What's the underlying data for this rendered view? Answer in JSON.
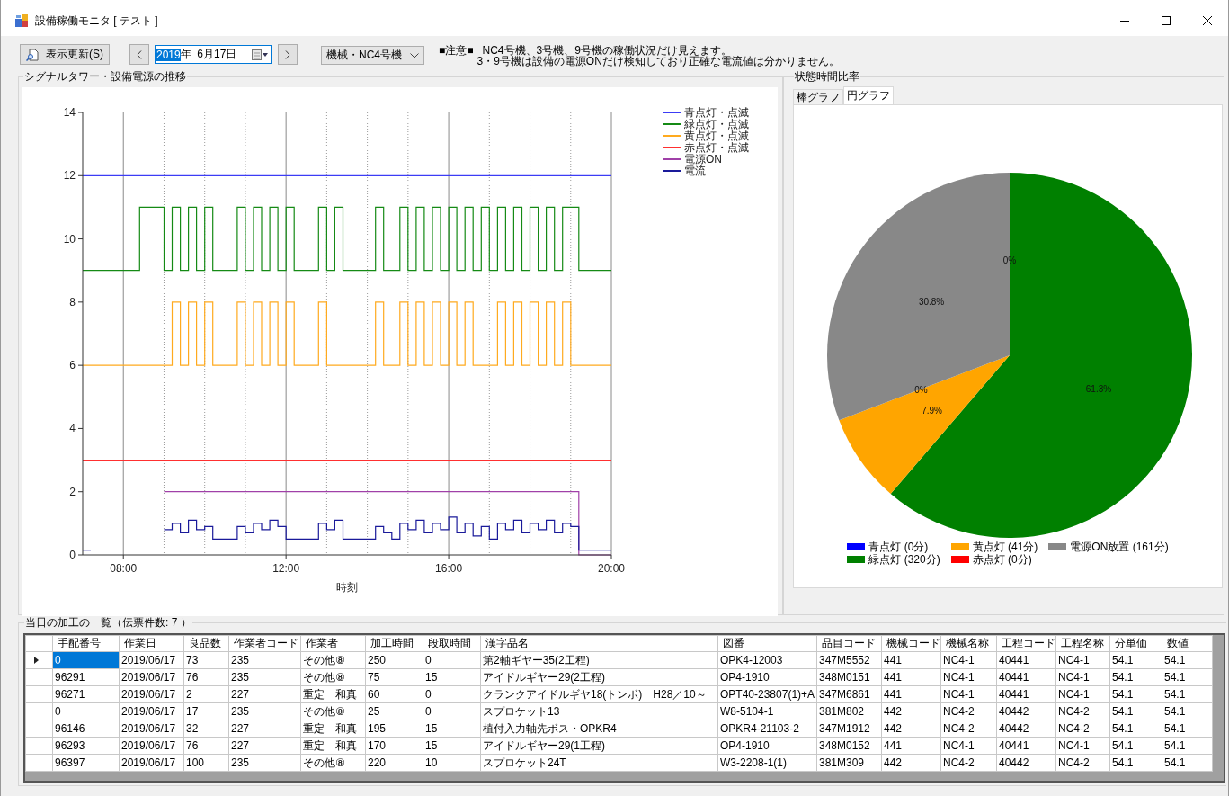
{
  "window": {
    "title": "設備稼働モニタ [ テスト ]"
  },
  "toolbar": {
    "refresh_button": "表示更新(S)",
    "date_picker": {
      "segments": [
        {
          "text": "2019",
          "selected": true
        },
        {
          "text": "年  6月17日",
          "selected": false
        }
      ]
    },
    "machine_combo": {
      "value": "機械・NC4号機"
    },
    "notice": {
      "label": "■注意■",
      "lines": [
        "NC4号機、3号機、9号機の稼働状況だけ見えます。",
        "3・9号機は設備の電源ONだけ検知しており正確な電流値は分かりません。"
      ]
    }
  },
  "signal_panel": {
    "title": "シグナルタワー・設備電源の推移",
    "chart_data": {
      "type": "line",
      "xlabel": "時刻",
      "xlim": [
        7,
        20
      ],
      "ylim": [
        0,
        14
      ],
      "grid": true,
      "legend": "right",
      "xticks": [
        {
          "value": 8,
          "label": "08:00"
        },
        {
          "value": 12,
          "label": "12:00"
        },
        {
          "value": 16,
          "label": "16:00"
        },
        {
          "value": 20,
          "label": "20:00"
        }
      ],
      "yticks": [
        0,
        2,
        4,
        6,
        8,
        10,
        12,
        14
      ],
      "x": [
        7,
        7.2,
        7.2,
        7.4,
        7.4,
        7.6,
        7.6,
        7.8,
        7.8,
        8,
        8,
        8.2,
        8.2,
        8.4,
        8.4,
        8.6,
        8.6,
        8.8,
        8.8,
        9,
        9,
        9.2,
        9.2,
        9.4,
        9.4,
        9.6,
        9.6,
        9.8,
        9.8,
        10,
        10,
        10.2,
        10.2,
        10.4,
        10.4,
        10.6,
        10.6,
        10.8,
        10.8,
        11,
        11,
        11.2,
        11.2,
        11.4,
        11.4,
        11.6,
        11.6,
        11.8,
        11.8,
        12,
        12,
        12.2,
        12.2,
        12.4,
        12.4,
        12.6,
        12.6,
        12.8,
        12.8,
        13,
        13,
        13.2,
        13.2,
        13.4,
        13.4,
        13.6,
        13.6,
        13.8,
        13.8,
        14,
        14,
        14.2,
        14.2,
        14.4,
        14.4,
        14.6,
        14.6,
        14.8,
        14.8,
        15,
        15,
        15.2,
        15.2,
        15.4,
        15.4,
        15.6,
        15.6,
        15.8,
        15.8,
        16,
        16,
        16.2,
        16.2,
        16.4,
        16.4,
        16.6,
        16.6,
        16.8,
        16.8,
        17,
        17,
        17.2,
        17.2,
        17.4,
        17.4,
        17.6,
        17.6,
        17.8,
        17.8,
        18,
        18,
        18.2,
        18.2,
        18.4,
        18.4,
        18.6,
        18.6,
        18.8,
        18.8,
        19,
        19,
        19.2,
        19.2,
        19.4,
        19.4,
        19.6,
        19.6,
        19.8,
        19.8,
        20
      ],
      "series": [
        {
          "name": "青点灯・点滅",
          "color": "#3c3cf5",
          "values": [
            12,
            12,
            12,
            12,
            12,
            12,
            12,
            12,
            12,
            12,
            12,
            12,
            12,
            12,
            12,
            12,
            12,
            12,
            12,
            12,
            12,
            12,
            12,
            12,
            12,
            12,
            12,
            12,
            12,
            12,
            12,
            12,
            12,
            12,
            12,
            12,
            12,
            12,
            12,
            12,
            12,
            12,
            12,
            12,
            12,
            12,
            12,
            12,
            12,
            12,
            12,
            12,
            12,
            12,
            12,
            12,
            12,
            12,
            12,
            12,
            12,
            12,
            12,
            12,
            12,
            12,
            12,
            12,
            12,
            12,
            12,
            12,
            12,
            12,
            12,
            12,
            12,
            12,
            12,
            12,
            12,
            12,
            12,
            12,
            12,
            12,
            12,
            12,
            12,
            12,
            12,
            12,
            12,
            12,
            12,
            12,
            12,
            12,
            12,
            12,
            12,
            12,
            12,
            12,
            12,
            12,
            12,
            12,
            12,
            12,
            12,
            12,
            12,
            12,
            12,
            12,
            12,
            12,
            12,
            12,
            12,
            12,
            12,
            12,
            12,
            12,
            12,
            12,
            12,
            12
          ]
        },
        {
          "name": "緑点灯・点滅",
          "color": "#158a15",
          "values": [
            9,
            9,
            9,
            9,
            9,
            9,
            9,
            9,
            9,
            9,
            9,
            9,
            9,
            9,
            11,
            11,
            11,
            11,
            11,
            11,
            9,
            9,
            11,
            11,
            9,
            9,
            11,
            11,
            9,
            9,
            11,
            11,
            9,
            9,
            9,
            9,
            9,
            9,
            11,
            11,
            9,
            9,
            11,
            11,
            9,
            9,
            11,
            11,
            9,
            9,
            11,
            11,
            9,
            9,
            9,
            9,
            9,
            9,
            11,
            11,
            9,
            9,
            11,
            11,
            9,
            9,
            9,
            9,
            9,
            9,
            9,
            9,
            11,
            11,
            9,
            9,
            9,
            9,
            11,
            11,
            9,
            9,
            11,
            11,
            9,
            9,
            11,
            11,
            9,
            9,
            11,
            11,
            9,
            9,
            11,
            11,
            9,
            9,
            11,
            11,
            9,
            9,
            11,
            11,
            9,
            9,
            11,
            11,
            9,
            9,
            11,
            11,
            9,
            9,
            11,
            11,
            9,
            9,
            11,
            11,
            11,
            11,
            9,
            9,
            9,
            9,
            9,
            9,
            9,
            9
          ]
        },
        {
          "name": "黄点灯・点滅",
          "color": "#ffaa1e",
          "values": [
            6,
            6,
            6,
            6,
            6,
            6,
            6,
            6,
            6,
            6,
            6,
            6,
            6,
            6,
            6,
            6,
            6,
            6,
            6,
            6,
            6,
            6,
            8,
            8,
            6,
            6,
            8,
            8,
            6,
            6,
            8,
            8,
            6,
            6,
            6,
            6,
            6,
            6,
            8,
            8,
            6,
            6,
            8,
            8,
            6,
            6,
            8,
            8,
            6,
            6,
            8,
            8,
            6,
            6,
            6,
            6,
            6,
            6,
            8,
            8,
            6,
            6,
            6,
            6,
            6,
            6,
            6,
            6,
            6,
            6,
            6,
            6,
            8,
            8,
            6,
            6,
            6,
            6,
            8,
            8,
            6,
            6,
            8,
            8,
            6,
            6,
            8,
            8,
            6,
            6,
            8,
            8,
            6,
            6,
            8,
            8,
            6,
            6,
            6,
            6,
            6,
            6,
            8,
            8,
            6,
            6,
            8,
            8,
            6,
            6,
            8,
            8,
            6,
            6,
            8,
            8,
            6,
            6,
            8,
            8,
            6,
            6,
            6,
            6,
            6,
            6,
            6,
            6,
            6,
            6
          ]
        },
        {
          "name": "赤点灯・点滅",
          "color": "#ff3030",
          "values": [
            3,
            3,
            3,
            3,
            3,
            3,
            3,
            3,
            3,
            3,
            3,
            3,
            3,
            3,
            3,
            3,
            3,
            3,
            3,
            3,
            3,
            3,
            3,
            3,
            3,
            3,
            3,
            3,
            3,
            3,
            3,
            3,
            3,
            3,
            3,
            3,
            3,
            3,
            3,
            3,
            3,
            3,
            3,
            3,
            3,
            3,
            3,
            3,
            3,
            3,
            3,
            3,
            3,
            3,
            3,
            3,
            3,
            3,
            3,
            3,
            3,
            3,
            3,
            3,
            3,
            3,
            3,
            3,
            3,
            3,
            3,
            3,
            3,
            3,
            3,
            3,
            3,
            3,
            3,
            3,
            3,
            3,
            3,
            3,
            3,
            3,
            3,
            3,
            3,
            3,
            3,
            3,
            3,
            3,
            3,
            3,
            3,
            3,
            3,
            3,
            3,
            3,
            3,
            3,
            3,
            3,
            3,
            3,
            3,
            3,
            3,
            3,
            3,
            3,
            3,
            3,
            3,
            3,
            3,
            3,
            3,
            3,
            3,
            3,
            3,
            3,
            3,
            3,
            3,
            3
          ]
        },
        {
          "name": "電源ON",
          "color": "#a040a8",
          "values": [
            null,
            null,
            null,
            null,
            null,
            null,
            null,
            null,
            null,
            null,
            null,
            null,
            null,
            null,
            null,
            null,
            null,
            null,
            null,
            null,
            2,
            2,
            2,
            2,
            2,
            2,
            2,
            2,
            2,
            2,
            2,
            2,
            2,
            2,
            2,
            2,
            2,
            2,
            2,
            2,
            2,
            2,
            2,
            2,
            2,
            2,
            2,
            2,
            2,
            2,
            2,
            2,
            2,
            2,
            2,
            2,
            2,
            2,
            2,
            2,
            2,
            2,
            2,
            2,
            2,
            2,
            2,
            2,
            2,
            2,
            2,
            2,
            2,
            2,
            2,
            2,
            2,
            2,
            2,
            2,
            2,
            2,
            2,
            2,
            2,
            2,
            2,
            2,
            2,
            2,
            2,
            2,
            2,
            2,
            2,
            2,
            2,
            2,
            2,
            2,
            2,
            2,
            2,
            2,
            2,
            2,
            2,
            2,
            2,
            2,
            2,
            2,
            2,
            2,
            2,
            2,
            2,
            2,
            2,
            2,
            2,
            2,
            0,
            0,
            0,
            0,
            0,
            0,
            0,
            0
          ]
        },
        {
          "name": "電流",
          "color": "#1a1a9a",
          "values": [
            0.15,
            0.15,
            null,
            null,
            null,
            null,
            null,
            null,
            null,
            null,
            null,
            null,
            null,
            null,
            null,
            null,
            null,
            null,
            null,
            null,
            0.8,
            0.8,
            1.0,
            1.0,
            0.7,
            0.7,
            1.1,
            1.1,
            0.8,
            0.8,
            0.9,
            0.9,
            0.5,
            0.5,
            0.5,
            0.5,
            0.5,
            0.5,
            0.9,
            0.9,
            0.7,
            0.7,
            1.0,
            1.0,
            0.8,
            0.8,
            1.1,
            1.1,
            0.9,
            0.9,
            0.5,
            0.5,
            0.5,
            0.5,
            0.5,
            0.5,
            0.5,
            0.5,
            1.0,
            1.0,
            0.8,
            0.8,
            1.1,
            1.1,
            0.5,
            0.5,
            0.5,
            0.5,
            0.5,
            0.5,
            0.5,
            0.5,
            0.9,
            0.9,
            0.7,
            0.7,
            0.5,
            0.5,
            1.0,
            1.0,
            0.8,
            0.8,
            1.1,
            1.1,
            0.7,
            0.7,
            1.0,
            1.0,
            0.8,
            0.8,
            1.2,
            1.2,
            0.7,
            0.7,
            1.0,
            1.0,
            0.6,
            0.6,
            0.9,
            0.9,
            0.5,
            0.5,
            1.0,
            1.0,
            0.8,
            0.8,
            1.1,
            1.1,
            0.7,
            0.7,
            1.0,
            1.0,
            0.8,
            0.8,
            1.1,
            1.1,
            0.7,
            0.7,
            1.0,
            1.0,
            0.9,
            0.9,
            0.15,
            0.15,
            0.15,
            0.15,
            0.15,
            0.15,
            0.15,
            0.15
          ]
        }
      ]
    }
  },
  "ratio_panel": {
    "title": "状態時間比率",
    "tabs": [
      {
        "label": "棒グラフ",
        "selected": false
      },
      {
        "label": "円グラフ",
        "selected": true
      }
    ],
    "chart_data": {
      "type": "pie",
      "legend": "bottom",
      "categories": [
        "青点灯 (0分)",
        "緑点灯 (320分)",
        "黄点灯 (41分)",
        "赤点灯 (0分)",
        "電源ON放置 (161分)"
      ],
      "values": [
        0,
        61.3,
        7.9,
        0,
        30.8
      ],
      "colors": [
        "#0000ff",
        "#008000",
        "#ffa500",
        "#ff0000",
        "#888888"
      ],
      "value_labels": [
        "0%",
        "61.3%",
        "7.9%",
        "0%",
        "30.8%"
      ]
    }
  },
  "work_list": {
    "title": "当日の加工の一覧（伝票件数: 7 ）",
    "table": {
      "columns": [
        "手配番号",
        "作業日",
        "良品数",
        "作業者コード",
        "作業者",
        "加工時間",
        "段取時間",
        "漢字品名",
        "図番",
        "品目コード",
        "機械コード",
        "機械名称",
        "工程コード",
        "工程名称",
        "分単価",
        "数値"
      ],
      "rows": [
        {
          "selected": true,
          "cells": [
            "0",
            "2019/06/17",
            "73",
            "235",
            "その他⑧",
            "250",
            "0",
            "第2軸ギヤー35(2工程)",
            "OPK4-12003",
            "347M5552",
            "441",
            "NC4-1",
            "40441",
            "NC4-1",
            "54.1",
            "54.1"
          ]
        },
        {
          "selected": false,
          "cells": [
            "96291",
            "2019/06/17",
            "76",
            "235",
            "その他⑧",
            "75",
            "15",
            "アイドルギヤー29(2工程)",
            "OP4-1910",
            "348M0151",
            "441",
            "NC4-1",
            "40441",
            "NC4-1",
            "54.1",
            "54.1"
          ]
        },
        {
          "selected": false,
          "cells": [
            "96271",
            "2019/06/17",
            "2",
            "227",
            "重定　和真",
            "60",
            "0",
            "クランクアイドルギヤ18(トンボ)　H28／10～",
            "OPT40-23807(1)+A",
            "347M6861",
            "441",
            "NC4-1",
            "40441",
            "NC4-1",
            "54.1",
            "54.1"
          ]
        },
        {
          "selected": false,
          "cells": [
            "0",
            "2019/06/17",
            "17",
            "235",
            "その他⑧",
            "25",
            "0",
            "スプロケット13",
            "W8-5104-1",
            "381M802",
            "442",
            "NC4-2",
            "40442",
            "NC4-2",
            "54.1",
            "54.1"
          ]
        },
        {
          "selected": false,
          "cells": [
            "96146",
            "2019/06/17",
            "32",
            "227",
            "重定　和真",
            "195",
            "15",
            "植付入力軸先ボス・OPKR4",
            "OPKR4-21103-2",
            "347M1912",
            "442",
            "NC4-2",
            "40442",
            "NC4-2",
            "54.1",
            "54.1"
          ]
        },
        {
          "selected": false,
          "cells": [
            "96293",
            "2019/06/17",
            "76",
            "227",
            "重定　和真",
            "170",
            "15",
            "アイドルギヤー29(1工程)",
            "OP4-1910",
            "348M0152",
            "441",
            "NC4-1",
            "40441",
            "NC4-1",
            "54.1",
            "54.1"
          ]
        },
        {
          "selected": false,
          "cells": [
            "96397",
            "2019/06/17",
            "100",
            "235",
            "その他⑧",
            "220",
            "10",
            "スプロケット24T",
            "W3-2208-1(1)",
            "381M309",
            "442",
            "NC4-2",
            "40442",
            "NC4-2",
            "54.1",
            "54.1"
          ]
        }
      ]
    }
  }
}
